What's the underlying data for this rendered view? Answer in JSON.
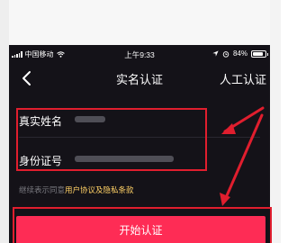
{
  "statusbar": {
    "carrier": "中国移动",
    "time": "上午9:33",
    "battery_percent": "84%",
    "battery_level": 0.84
  },
  "navbar": {
    "title": "实名认证",
    "right_action": "人工认证"
  },
  "form": {
    "name_label": "真实姓名",
    "id_label": "身份证号"
  },
  "agreement": {
    "prefix": "继续表示同意",
    "link": "用户协议及隐私条款"
  },
  "start_button": "开始认证",
  "colors": {
    "accent": "#fe2c55",
    "highlight": "#e01e2e",
    "link": "#ffd166",
    "background": "#141218"
  }
}
